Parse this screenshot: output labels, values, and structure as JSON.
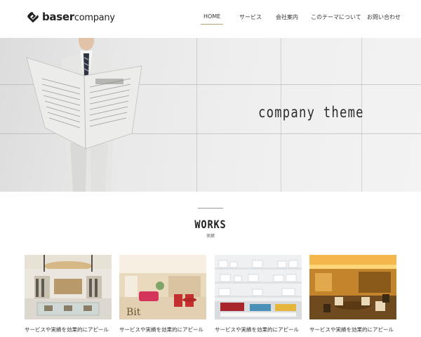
{
  "header": {
    "logo_main": "baser",
    "logo_sub": "company",
    "nav": [
      {
        "label": "HOME",
        "active": true
      },
      {
        "label": "サービス",
        "active": false
      },
      {
        "label": "会社案内",
        "active": false
      },
      {
        "label": "このテーマについて",
        "active": false
      },
      {
        "label": "お問い合わせ",
        "active": false
      }
    ]
  },
  "hero": {
    "title": "company theme"
  },
  "works": {
    "title": "WORKS",
    "subtitle": "実績",
    "items": [
      {
        "caption": "サービスや実績を効果的にアピール",
        "image": "store-interior"
      },
      {
        "caption": "サービスや実績を効果的にアピール",
        "image": "lounge-interior"
      },
      {
        "caption": "サービスや実績を効果的にアピール",
        "image": "tableware-shelves"
      },
      {
        "caption": "サービスや実績を効果的にアピール",
        "image": "hotel-lobby"
      }
    ]
  },
  "colors": {
    "accent": "#b8a67a",
    "text": "#333333"
  }
}
